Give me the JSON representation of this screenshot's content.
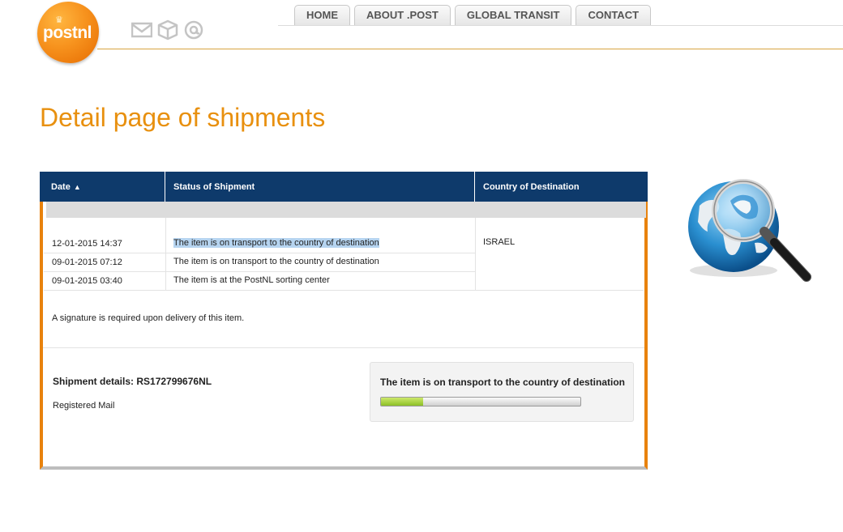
{
  "brand": {
    "logo_text": "postnl",
    "crown": "♛"
  },
  "service_icons": [
    "mail-icon",
    "parcel-icon",
    "at-sign-icon"
  ],
  "nav": [
    "HOME",
    "ABOUT .POST",
    "GLOBAL TRANSIT",
    "CONTACT"
  ],
  "page_title": "Detail page of shipments",
  "table": {
    "headers": {
      "date": "Date",
      "status": "Status of Shipment",
      "country": "Country of Destination"
    },
    "country": "ISRAEL",
    "rows": [
      {
        "date": "12-01-2015 14:37",
        "status": "The item is on transport to the country of destination"
      },
      {
        "date": "09-01-2015 07:12",
        "status": "The item is on transport to the country of destination"
      },
      {
        "date": "09-01-2015 03:40",
        "status": "The item is at the PostNL sorting center"
      }
    ]
  },
  "signature_note": "A signature is required upon delivery of this item.",
  "shipment": {
    "details_label": "Shipment details: RS172799676NL",
    "type": "Registered Mail",
    "progress_label": "The item is on transport to the country of destination",
    "progress_fraction": 0.21
  },
  "colors": {
    "accent": "#e8900f",
    "header_blue": "#0e3a6b",
    "progress_green": "#8cbf26"
  }
}
